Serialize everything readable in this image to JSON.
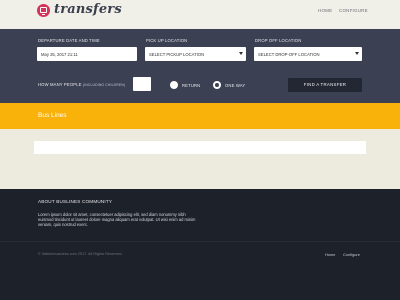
{
  "brand": {
    "name": "transfers",
    "logo_icon": "monitor-icon",
    "logo_color": "#d6335a"
  },
  "nav": {
    "home": "HOME",
    "configure": "CONFIGURE"
  },
  "search": {
    "departure_label": "DEPARTURE DATE AND TIME",
    "departure_value": "May 25, 2017 21:11",
    "pickup_label": "PICK UP LOCATION",
    "pickup_value": "SELECT PICKUP LOCATION",
    "dropoff_label": "DROP OFF LOCATION",
    "dropoff_value": "SELECT DROP-OFF LOCATION",
    "people_label": "HOW MANY PEOPLE",
    "people_hint": "(INCLUDING CHILDREN)",
    "people_value": "",
    "return_label": "RETURN",
    "oneway_label": "ONE WAY",
    "selected_trip": "ONE WAY",
    "find_button": "FIND A TRANSFER"
  },
  "bus_lines": {
    "title": "Bus Lines",
    "color": "#f9b20a"
  },
  "footer": {
    "about_title": "ABOUT BUSLINES COMMUNITY",
    "about_text": "Lorem ipsum dolor sit amet, consectetuer adipiscing elit, sed diam nonummy nibh euismod tincidunt ut laoreet dolore magna aliquam erat volutpat. Ut wisi enim ad minim veniam, quis nostrud exerc.",
    "copyright": "© Walkerbusiness.com 2017. All Rights Reserved.",
    "home_link": "Home",
    "configure_link": "Configure"
  },
  "colors": {
    "panel": "#3b4052",
    "footer": "#1d212a",
    "background": "#ecebdd",
    "button": "#232733"
  }
}
